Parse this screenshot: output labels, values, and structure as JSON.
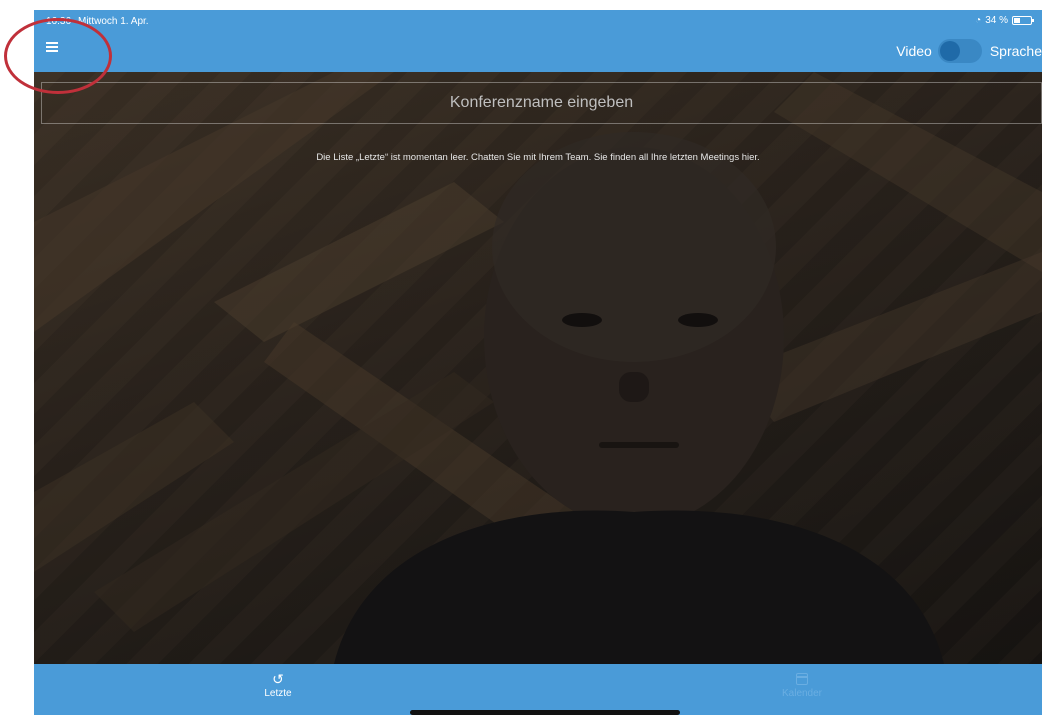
{
  "status_bar": {
    "time": "16:36",
    "date": "Mittwoch 1. Apr.",
    "battery": "34 %",
    "wifi_icon": "wifi-icon",
    "battery_icon": "battery-icon"
  },
  "header": {
    "menu_icon": "hamburger-menu-icon",
    "video_label": "Video",
    "voice_label": "Sprache",
    "toggle_on": false
  },
  "conference": {
    "placeholder": "Konferenzname eingeben",
    "value": ""
  },
  "recent": {
    "empty_message": "Die Liste „Letzte“ ist momentan leer. Chatten Sie mit Ihrem Team. Sie finden all Ihre letzten Meetings hier."
  },
  "tabs": [
    {
      "label": "Letzte",
      "icon": "history-icon",
      "active": true
    },
    {
      "label": "Kalender",
      "icon": "calendar-icon",
      "active": false
    }
  ],
  "colors": {
    "accent": "#4a9bd8",
    "annotation": "#c0303a"
  }
}
